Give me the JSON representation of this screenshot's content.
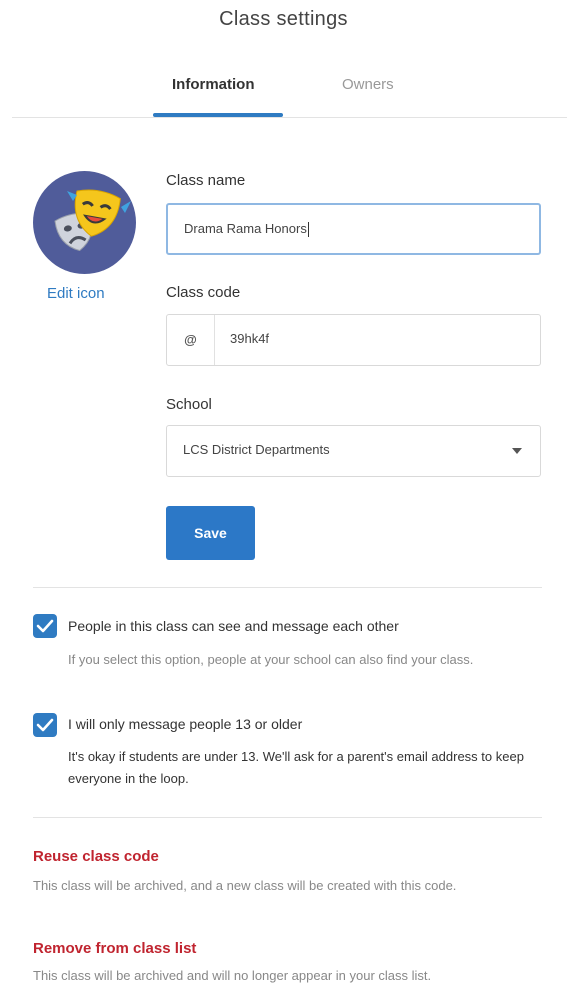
{
  "page": {
    "title": "Class settings"
  },
  "tabs": [
    {
      "label": "Information",
      "active": true
    },
    {
      "label": "Owners",
      "active": false
    }
  ],
  "avatar": {
    "icon": "drama-masks-icon",
    "edit_label": "Edit icon"
  },
  "form": {
    "class_name": {
      "label": "Class name",
      "value": "Drama Rama Honors"
    },
    "class_code": {
      "label": "Class code",
      "prefix": "@",
      "value": "39hk4f"
    },
    "school": {
      "label": "School",
      "selected": "LCS District Departments"
    },
    "save_label": "Save"
  },
  "options": [
    {
      "checked": true,
      "label": "People in this class can see and message each other",
      "help": "If you select this option, people at your school can also find your class."
    },
    {
      "checked": true,
      "label": "I will only message people 13 or older",
      "help": "It's okay if students are under 13. We'll ask for a parent's email address to keep everyone in the loop."
    }
  ],
  "actions": {
    "reuse": {
      "label": "Reuse class code",
      "description": "This class will be archived, and a new class will be created with this code."
    },
    "remove": {
      "label": "Remove from class list",
      "description": "This class will be archived and will no longer appear in your class list."
    }
  },
  "colors": {
    "accent": "#2f7bc2",
    "danger": "#c0242f",
    "avatar_bg": "#505c9a"
  }
}
